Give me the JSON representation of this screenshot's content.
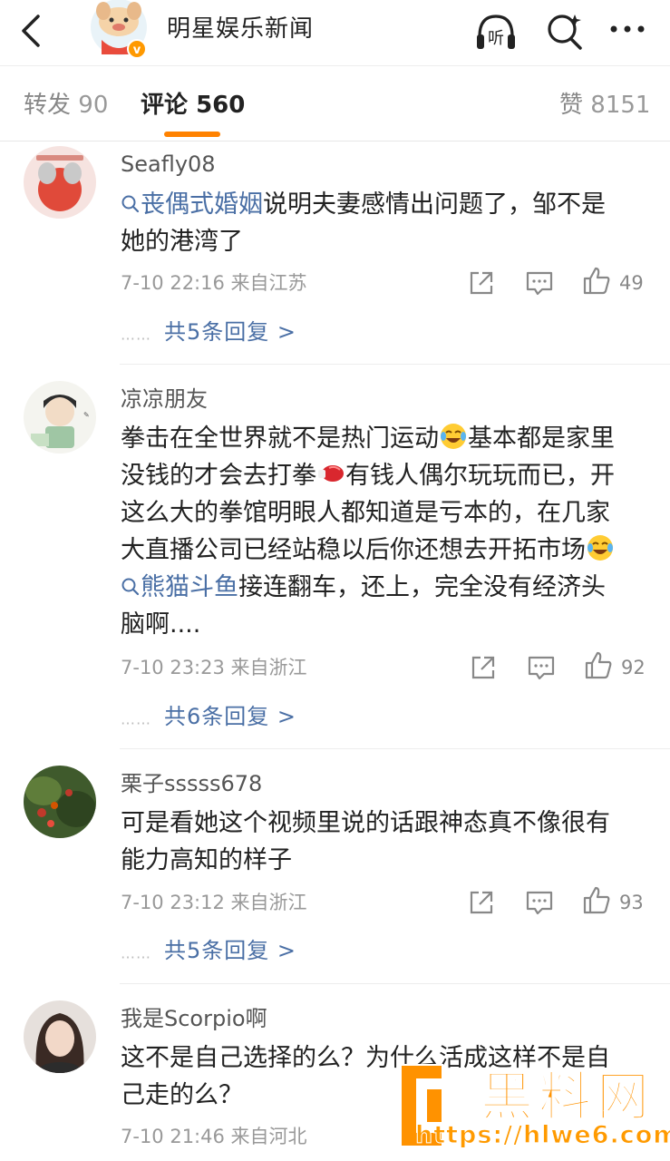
{
  "header": {
    "title": "明星娱乐新闻"
  },
  "tabs": {
    "repost_label": "转发",
    "repost_count": "90",
    "comment_label": "评论",
    "comment_count": "560",
    "like_label": "赞",
    "like_count": "8151"
  },
  "colors": {
    "accent": "#ff8200",
    "link": "#4a6fa5",
    "watermark": "#ff9200"
  },
  "comments": [
    {
      "user": "Seafly08",
      "topic": "丧偶式婚姻",
      "text_line1_rest": "说明夫妻感情出问题了，邹不是",
      "text_line2": "她的港湾了",
      "time": "7-10 22:16",
      "source": "来自江苏",
      "likes": "49",
      "replies": "共5条回复 >"
    },
    {
      "user": "凉凉朋友",
      "line1_a": "拳击在全世界就不是热门运动",
      "line1_b": "基本都是家里",
      "line2_a": "没钱的才会去打拳",
      "line2_b": "有钱人偶尔玩玩而已，开",
      "line3": "这么大的拳馆明眼人都知道是亏本的，在几家",
      "line4": "大直播公司已经站稳以后你还想去开拓市场",
      "topic": "熊猫斗鱼",
      "line5_rest": "接连翻车，还上，完全没有经济头",
      "line6": "脑啊....",
      "time": "7-10 23:23",
      "source": "来自浙江",
      "likes": "92",
      "replies": "共6条回复 >"
    },
    {
      "user": "栗子sssss678",
      "text_line1": "可是看她这个视频里说的话跟神态真不像很有",
      "text_line2": "能力高知的样子",
      "time": "7-10 23:12",
      "source": "来自浙江",
      "likes": "93",
      "replies": "共5条回复 >"
    },
    {
      "user": "我是Scorpio啊",
      "text_line1": "这不是自己选择的么？为什么活成这样不是自",
      "text_line2": "己走的么？",
      "time": "7-10 21:46",
      "source": "来自河北"
    }
  ],
  "watermark": {
    "text": "黑料网",
    "url": "https://hlwe6.com"
  }
}
